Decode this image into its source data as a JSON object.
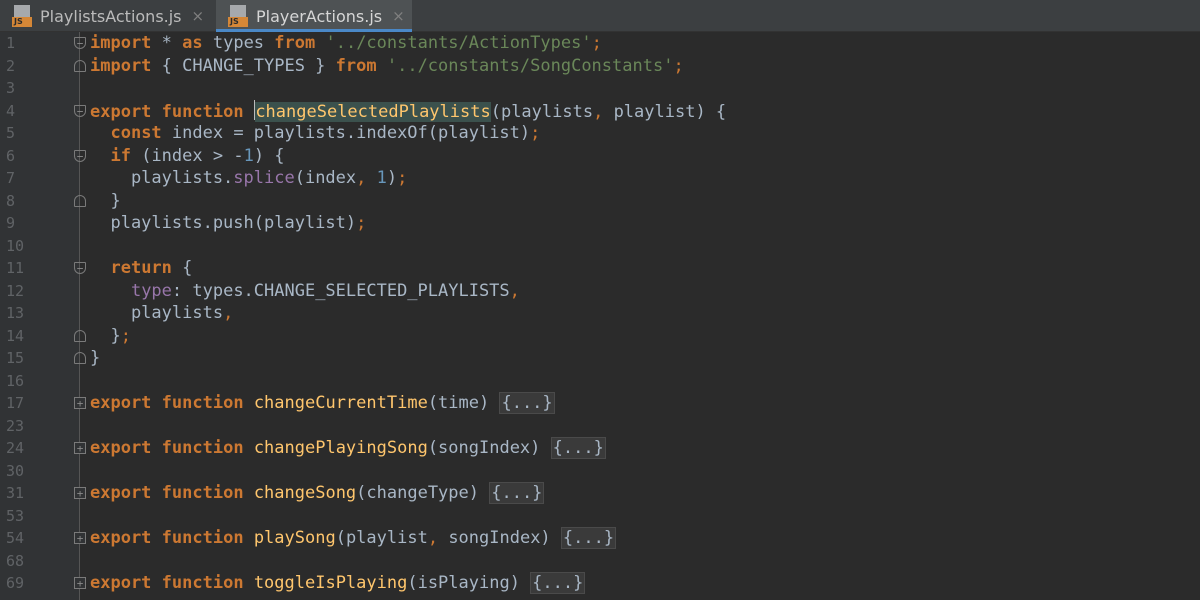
{
  "tabs": [
    {
      "label": "PlaylistsActions.js",
      "icon": "js-file-icon",
      "icon_text": "JS",
      "close": "×",
      "active": false
    },
    {
      "label": "PlayerActions.js",
      "icon": "js-file-icon",
      "icon_text": "JS",
      "close": "×",
      "active": true
    }
  ],
  "editor": {
    "lines": [
      {
        "number": "1",
        "fold": "open",
        "tokens": [
          [
            "kw",
            "import"
          ],
          [
            "p",
            " * "
          ],
          [
            "kw",
            "as"
          ],
          [
            "p",
            " types "
          ],
          [
            "kw",
            "from"
          ],
          [
            "p",
            " "
          ],
          [
            "str",
            "'../constants/ActionTypes'"
          ],
          [
            "semi",
            ";"
          ]
        ]
      },
      {
        "number": "2",
        "fold": "close",
        "tokens": [
          [
            "kw",
            "import"
          ],
          [
            "p",
            " { CHANGE_TYPES } "
          ],
          [
            "kw",
            "from"
          ],
          [
            "p",
            " "
          ],
          [
            "str",
            "'../constants/SongConstants'"
          ],
          [
            "semi",
            ";"
          ]
        ]
      },
      {
        "number": "3",
        "fold": "",
        "tokens": []
      },
      {
        "number": "4",
        "fold": "open",
        "tokens": [
          [
            "kw",
            "export"
          ],
          [
            "p",
            " "
          ],
          [
            "kw",
            "function"
          ],
          [
            "p",
            " "
          ],
          [
            "caret",
            ""
          ],
          [
            "fn-hl",
            "changeSelectedPlaylists"
          ],
          [
            "p",
            "(playlists"
          ],
          [
            "semi",
            ","
          ],
          [
            "p",
            " playlist) {"
          ]
        ]
      },
      {
        "number": "5",
        "fold": "",
        "tokens": [
          [
            "p",
            "  "
          ],
          [
            "kw",
            "const"
          ],
          [
            "p",
            " index = playlists.indexOf(playlist)"
          ],
          [
            "semi",
            ";"
          ]
        ]
      },
      {
        "number": "6",
        "fold": "open",
        "tokens": [
          [
            "p",
            "  "
          ],
          [
            "kw",
            "if"
          ],
          [
            "p",
            " (index > -"
          ],
          [
            "num",
            "1"
          ],
          [
            "p",
            ") {"
          ]
        ]
      },
      {
        "number": "7",
        "fold": "",
        "tokens": [
          [
            "p",
            "    playlists."
          ],
          [
            "prop",
            "splice"
          ],
          [
            "p",
            "(index"
          ],
          [
            "semi",
            ","
          ],
          [
            "p",
            " "
          ],
          [
            "num",
            "1"
          ],
          [
            "p",
            ")"
          ],
          [
            "semi",
            ";"
          ]
        ]
      },
      {
        "number": "8",
        "fold": "close",
        "tokens": [
          [
            "p",
            "  }"
          ]
        ]
      },
      {
        "number": "9",
        "fold": "",
        "tokens": [
          [
            "p",
            "  playlists.push(playlist)"
          ],
          [
            "semi",
            ";"
          ]
        ]
      },
      {
        "number": "10",
        "fold": "",
        "tokens": []
      },
      {
        "number": "11",
        "fold": "open",
        "tokens": [
          [
            "p",
            "  "
          ],
          [
            "kw",
            "return"
          ],
          [
            "p",
            " {"
          ]
        ]
      },
      {
        "number": "12",
        "fold": "",
        "tokens": [
          [
            "p",
            "    "
          ],
          [
            "prop",
            "type"
          ],
          [
            "p",
            ": types.CHANGE_SELECTED_PLAYLISTS"
          ],
          [
            "semi",
            ","
          ]
        ]
      },
      {
        "number": "13",
        "fold": "",
        "tokens": [
          [
            "p",
            "    playlists"
          ],
          [
            "semi",
            ","
          ]
        ]
      },
      {
        "number": "14",
        "fold": "close",
        "tokens": [
          [
            "p",
            "  }"
          ],
          [
            "semi",
            ";"
          ]
        ]
      },
      {
        "number": "15",
        "fold": "close",
        "tokens": [
          [
            "p",
            "}"
          ]
        ]
      },
      {
        "number": "16",
        "fold": "",
        "tokens": []
      },
      {
        "number": "17",
        "fold": "box",
        "tokens": [
          [
            "kw",
            "export"
          ],
          [
            "p",
            " "
          ],
          [
            "kw",
            "function"
          ],
          [
            "p",
            " "
          ],
          [
            "fn",
            "changeCurrentTime"
          ],
          [
            "p",
            "(time) "
          ],
          [
            "folded",
            "{...}"
          ]
        ]
      },
      {
        "number": "23",
        "fold": "",
        "tokens": []
      },
      {
        "number": "24",
        "fold": "box",
        "tokens": [
          [
            "kw",
            "export"
          ],
          [
            "p",
            " "
          ],
          [
            "kw",
            "function"
          ],
          [
            "p",
            " "
          ],
          [
            "fn",
            "changePlayingSong"
          ],
          [
            "p",
            "(songIndex) "
          ],
          [
            "folded",
            "{...}"
          ]
        ]
      },
      {
        "number": "30",
        "fold": "",
        "tokens": []
      },
      {
        "number": "31",
        "fold": "box",
        "tokens": [
          [
            "kw",
            "export"
          ],
          [
            "p",
            " "
          ],
          [
            "kw",
            "function"
          ],
          [
            "p",
            " "
          ],
          [
            "fn",
            "changeSong"
          ],
          [
            "p",
            "(changeType) "
          ],
          [
            "folded",
            "{...}"
          ]
        ]
      },
      {
        "number": "53",
        "fold": "",
        "tokens": []
      },
      {
        "number": "54",
        "fold": "box",
        "tokens": [
          [
            "kw",
            "export"
          ],
          [
            "p",
            " "
          ],
          [
            "kw",
            "function"
          ],
          [
            "p",
            " "
          ],
          [
            "fn",
            "playSong"
          ],
          [
            "p",
            "(playlist"
          ],
          [
            "semi",
            ","
          ],
          [
            "p",
            " songIndex) "
          ],
          [
            "folded",
            "{...}"
          ]
        ]
      },
      {
        "number": "68",
        "fold": "",
        "tokens": []
      },
      {
        "number": "69",
        "fold": "box",
        "tokens": [
          [
            "kw",
            "export"
          ],
          [
            "p",
            " "
          ],
          [
            "kw",
            "function"
          ],
          [
            "p",
            " "
          ],
          [
            "fn",
            "toggleIsPlaying"
          ],
          [
            "p",
            "(isPlaying) "
          ],
          [
            "folded",
            "{...}"
          ]
        ]
      }
    ]
  },
  "colors": {
    "background": "#2b2b2b",
    "gutter": "#313335",
    "keyword": "#cc7832",
    "string": "#6a8759",
    "function": "#ffc66d",
    "number": "#6897bb",
    "property": "#9876aa",
    "text": "#a9b7c6",
    "line_number": "#606366",
    "tab_accent": "#4a88c7"
  }
}
